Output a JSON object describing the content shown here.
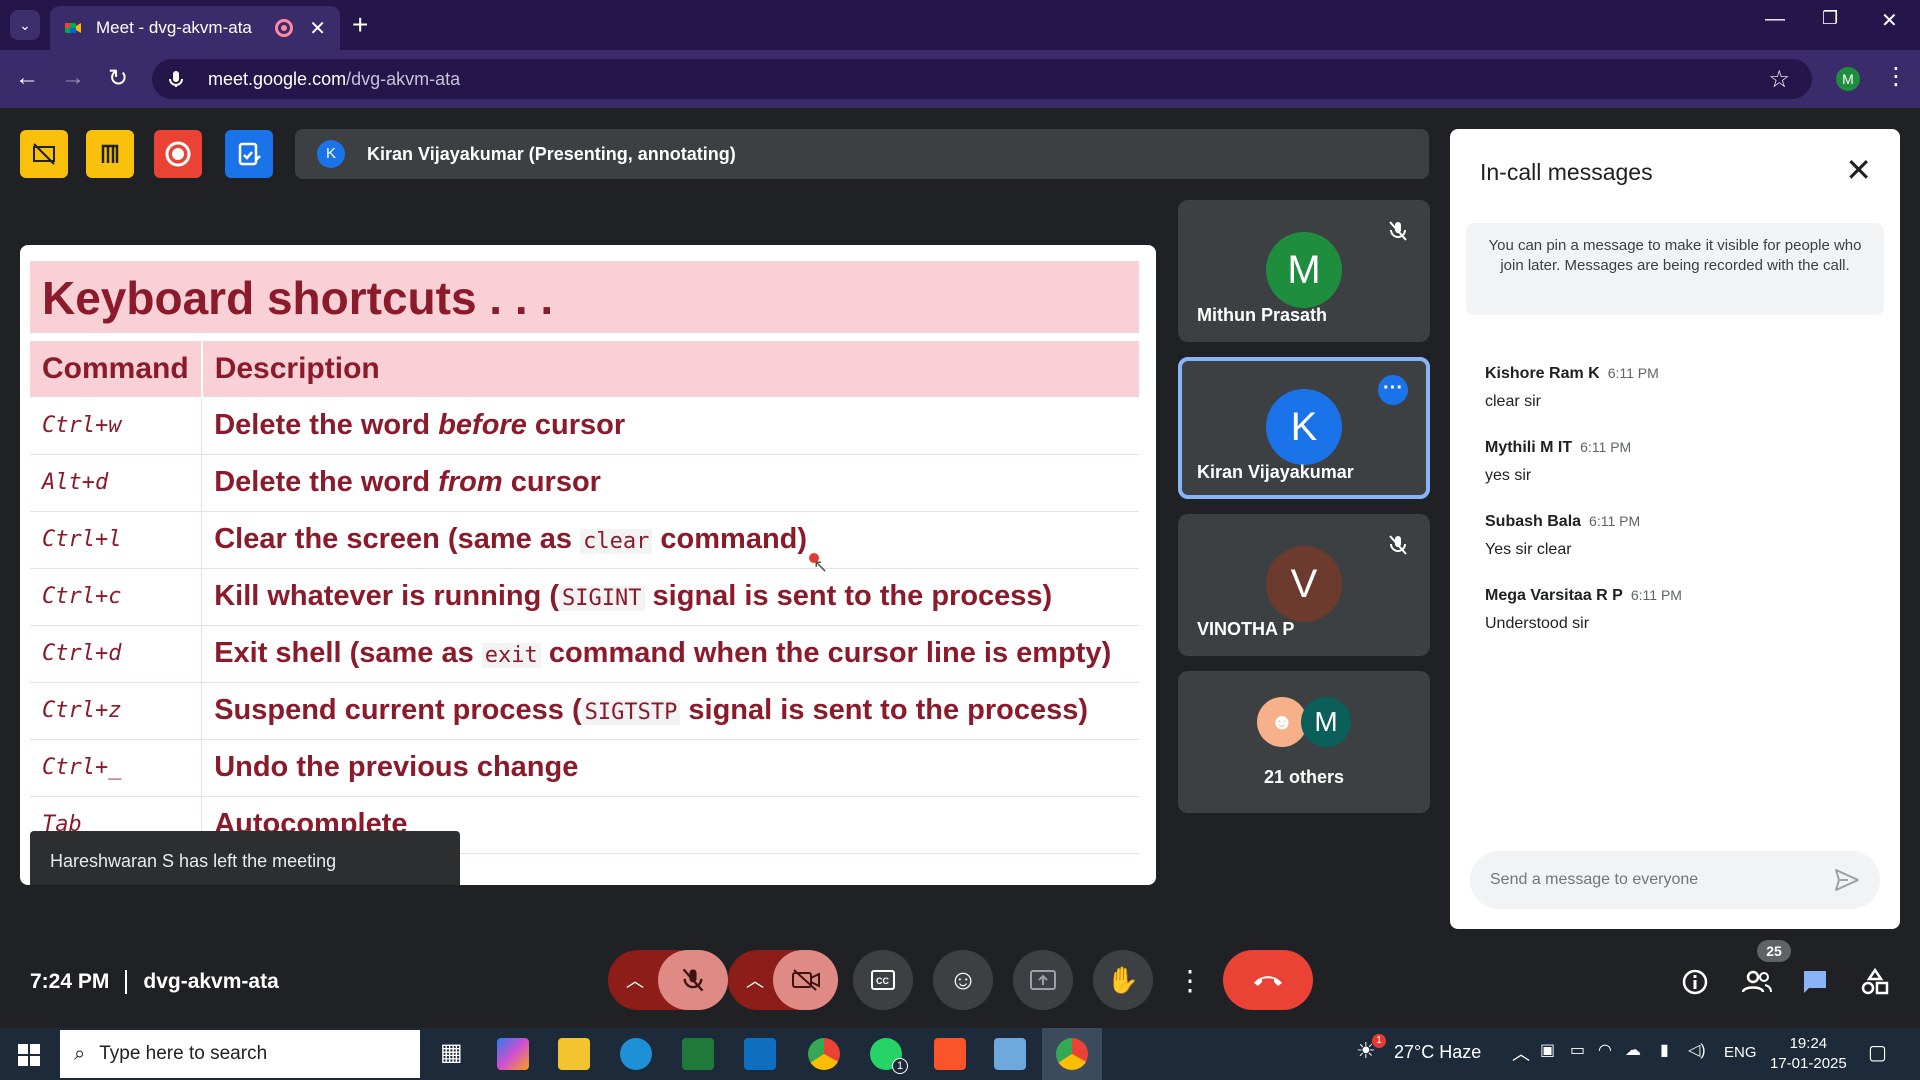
{
  "browser": {
    "tab_title": "Meet - dvg-akvm-ata",
    "url_domain": "meet.google.com",
    "url_path": "/dvg-akvm-ata",
    "profile_initial": "M"
  },
  "meet": {
    "presenter_initial": "K",
    "presenter_label": "Kiran Vijayakumar (Presenting, annotating)",
    "slide": {
      "title": "Keyboard shortcuts . . .",
      "headers": [
        "Command",
        "Description"
      ],
      "rows": [
        {
          "cmd": "Ctrl+w",
          "pre": "Delete the word ",
          "em": "before",
          "code": "",
          "post": " cursor"
        },
        {
          "cmd": "Alt+d",
          "pre": "Delete the word ",
          "em": "from",
          "code": "",
          "post": " cursor"
        },
        {
          "cmd": "Ctrl+l",
          "pre": "Clear the screen (same as ",
          "em": "",
          "code": "clear",
          "post": " command)"
        },
        {
          "cmd": "Ctrl+c",
          "pre": "Kill whatever is running (",
          "em": "",
          "code": "SIGINT",
          "post": " signal is sent to the process)"
        },
        {
          "cmd": "Ctrl+d",
          "pre": "Exit shell (same as ",
          "em": "",
          "code": "exit",
          "post": " command when the cursor line is empty)"
        },
        {
          "cmd": "Ctrl+z",
          "pre": "Suspend current process (",
          "em": "",
          "code": "SIGTSTP",
          "post": " signal is sent to the process)"
        },
        {
          "cmd": "Ctrl+_",
          "pre": "Undo the previous change",
          "em": "",
          "code": "",
          "post": ""
        },
        {
          "cmd": "Tab",
          "pre": "Autocomplete",
          "em": "",
          "code": "",
          "post": ""
        }
      ]
    },
    "toast": "Hareshwaran S has left the meeting",
    "tiles": [
      {
        "initial": "M",
        "name": "Mithun Prasath",
        "color": "#1e8e3e"
      },
      {
        "initial": "K",
        "name": "Kiran Vijayakumar",
        "color": "#1a73e8"
      },
      {
        "initial": "V",
        "name": "VINOTHA P",
        "color": "#6d3b2e"
      }
    ],
    "others": {
      "initial": "M",
      "label": "21 others"
    },
    "meeting_time": "7:24 PM",
    "meeting_code": "dvg-akvm-ata",
    "participant_count": "25"
  },
  "chat": {
    "title": "In-call messages",
    "note": "You can pin a message to make it visible for people who join later. Messages are being recorded with the call.",
    "messages": [
      {
        "sender": "Kishore Ram K",
        "time": "6:11 PM",
        "text": "clear sir"
      },
      {
        "sender": "Mythili M IT",
        "time": "6:11 PM",
        "text": "yes sir"
      },
      {
        "sender": "Subash Bala",
        "time": "6:11 PM",
        "text": "Yes sir clear"
      },
      {
        "sender": "Mega Varsitaa R P",
        "time": "6:11 PM",
        "text": "Understood sir"
      }
    ],
    "input_placeholder": "Send a message to everyone"
  },
  "taskbar": {
    "search_placeholder": "Type here to search",
    "weather": "27°C  Haze",
    "language": "ENG",
    "time": "19:24",
    "date": "17-01-2025",
    "whatsapp_badge": "1",
    "weather_badge": "1"
  },
  "colors": {
    "accent": "#1a73e8",
    "hangup": "#ea4335",
    "slide_text": "#8b1a2b",
    "slide_header": "#f8d0d6"
  }
}
